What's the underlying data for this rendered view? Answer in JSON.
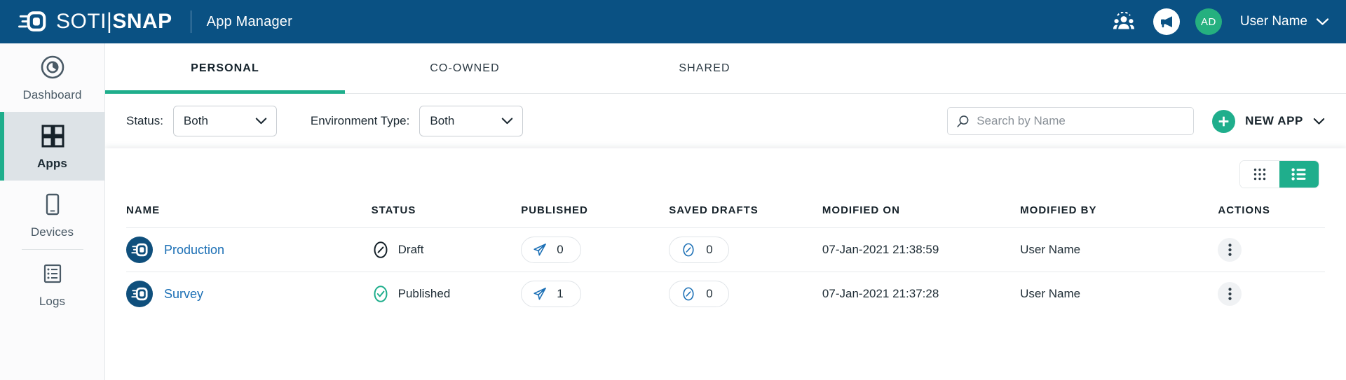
{
  "header": {
    "brand_light": "SOTI",
    "brand_bar": "|",
    "brand_bold": "SNAP",
    "module_title": "App Manager",
    "community_icon": "people-community-icon",
    "announcement_icon": "megaphone-icon",
    "avatar_initials": "AD",
    "user_name": "User Name",
    "user_chevron": "chevron-down-icon",
    "bg_color": "#0a5183"
  },
  "sidebar": {
    "items": [
      {
        "label": "Dashboard",
        "icon": "dashboard-donut-icon",
        "active": false
      },
      {
        "label": "Apps",
        "icon": "apps-grid-icon",
        "active": true
      },
      {
        "label": "Devices",
        "icon": "device-phone-icon",
        "active": false
      },
      {
        "label": "Logs",
        "icon": "logs-list-icon",
        "active": false
      }
    ],
    "active_accent_color": "#1fae8c"
  },
  "tabs": [
    {
      "label": "PERSONAL",
      "active": true
    },
    {
      "label": "CO-OWNED",
      "active": false
    },
    {
      "label": "SHARED",
      "active": false
    }
  ],
  "filters": {
    "status": {
      "label": "Status:",
      "value": "Both"
    },
    "environment": {
      "label": "Environment Type:",
      "value": "Both"
    }
  },
  "search": {
    "placeholder": "Search by Name",
    "value": "",
    "icon": "search-icon"
  },
  "new_app": {
    "label": "NEW APP",
    "plus_icon": "plus-icon",
    "chevron": "chevron-down-icon",
    "accent_color": "#1fae8c"
  },
  "view_toggle": {
    "grid": {
      "icon": "grid-view-icon",
      "active": false
    },
    "list": {
      "icon": "list-view-icon",
      "active": true
    }
  },
  "table": {
    "columns": [
      "NAME",
      "STATUS",
      "PUBLISHED",
      "SAVED DRAFTS",
      "MODIFIED ON",
      "MODIFIED BY",
      "ACTIONS"
    ],
    "rows": [
      {
        "name": "Production",
        "app_icon": "soti-app-icon",
        "status": "Draft",
        "status_icon": "draft-circle-slash-icon",
        "published_count": "0",
        "published_icon": "paper-plane-icon",
        "drafts_count": "0",
        "drafts_icon": "draft-circle-slash-icon",
        "modified_on": "07-Jan-2021 21:38:59",
        "modified_by": "User Name",
        "actions_icon": "kebab-menu-icon"
      },
      {
        "name": "Survey",
        "app_icon": "soti-app-icon",
        "status": "Published",
        "status_icon": "published-check-circle-icon",
        "published_count": "1",
        "published_icon": "paper-plane-icon",
        "drafts_count": "0",
        "drafts_icon": "draft-circle-slash-icon",
        "modified_on": "07-Jan-2021 21:37:28",
        "modified_by": "User Name",
        "actions_icon": "kebab-menu-icon"
      }
    ]
  }
}
